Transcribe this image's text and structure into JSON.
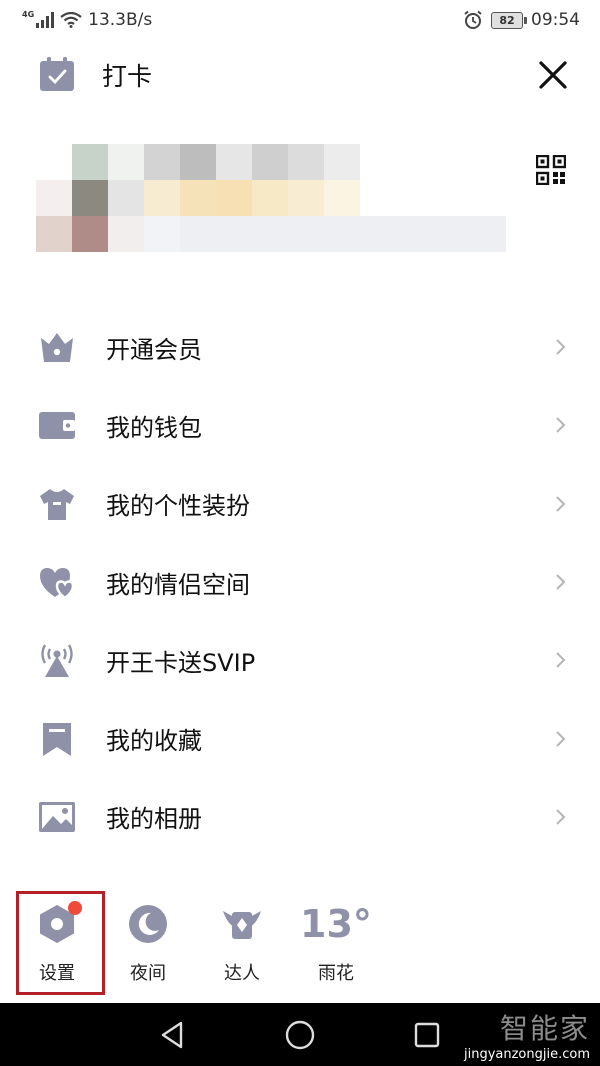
{
  "status_bar": {
    "network": "4G",
    "speed": "13.3B/s",
    "battery": "82",
    "time": "09:54"
  },
  "header": {
    "title": "打卡"
  },
  "menu": [
    {
      "label": "开通会员",
      "icon": "crown-icon"
    },
    {
      "label": "我的钱包",
      "icon": "wallet-icon"
    },
    {
      "label": "我的个性装扮",
      "icon": "tshirt-icon"
    },
    {
      "label": "我的情侣空间",
      "icon": "hearts-icon"
    },
    {
      "label": "开王卡送SVIP",
      "icon": "antenna-icon"
    },
    {
      "label": "我的收藏",
      "icon": "bookmark-icon"
    },
    {
      "label": "我的相册",
      "icon": "image-icon"
    }
  ],
  "bottom_bar": {
    "settings": "设置",
    "night": "夜间",
    "talent": "达人",
    "temperature": "13°",
    "weather": "雨花"
  },
  "watermark": {
    "top": "智能家",
    "bottom": "jingyanzongjie.com"
  },
  "colors": {
    "icon_gray": "#8e91a8",
    "highlight": "#b3202a",
    "badge": "#f04a3a"
  }
}
